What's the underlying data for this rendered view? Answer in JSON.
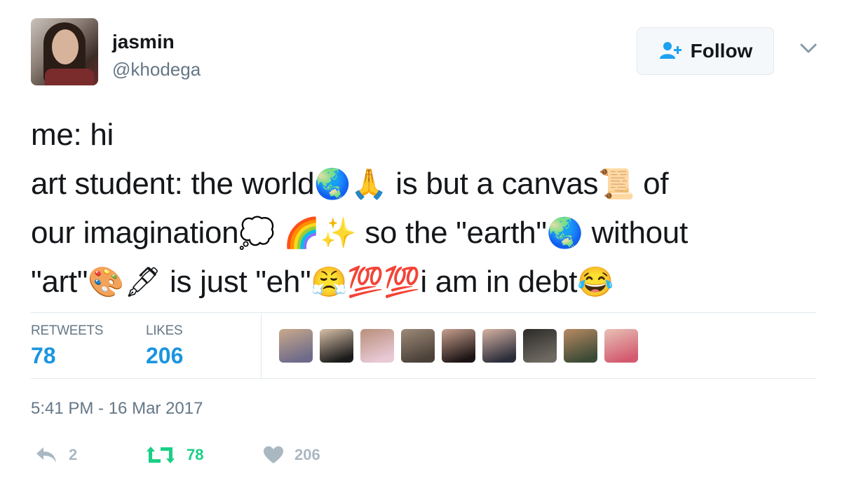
{
  "user": {
    "display_name": "jasmin",
    "handle": "@khodega"
  },
  "follow_button": {
    "label": "Follow",
    "icon": "person-add-icon"
  },
  "tweet": {
    "lines": [
      [
        "me: hi"
      ],
      [
        "art student: the world",
        "🌏",
        "🙏",
        " is but a canvas",
        "📜",
        " of"
      ],
      [
        "our imagination",
        "💭",
        " ",
        "🌈",
        "✨",
        " so the \"earth\"",
        "🌏",
        " without"
      ],
      [
        "\"art\"",
        "🎨",
        "🖋",
        " is just \"eh\"",
        "😤",
        "💯",
        "💯",
        "i am in debt",
        "😂"
      ]
    ]
  },
  "stats": {
    "retweets_label": "RETWEETS",
    "retweets_value": "78",
    "likes_label": "LIKES",
    "likes_value": "206"
  },
  "likers": [
    {
      "color_a": "#6d6a8a",
      "color_b": "#c9a98b"
    },
    {
      "color_a": "#1a1a1a",
      "color_b": "#d8c0a8"
    },
    {
      "color_a": "#e8c9d6",
      "color_b": "#b98f7a"
    },
    {
      "color_a": "#4a4038",
      "color_b": "#9d8a78"
    },
    {
      "color_a": "#1c1414",
      "color_b": "#c79f8e"
    },
    {
      "color_a": "#2b2d3a",
      "color_b": "#d6b3a3"
    },
    {
      "color_a": "#6e6a62",
      "color_b": "#2c2a28"
    },
    {
      "color_a": "#3b4a34",
      "color_b": "#b88a64"
    },
    {
      "color_a": "#d35a6f",
      "color_b": "#e8c1b6"
    }
  ],
  "timestamp": "5:41 PM - 16 Mar 2017",
  "actions": {
    "reply_count": "2",
    "retweet_count": "78",
    "like_count": "206"
  },
  "colors": {
    "accent_blue": "#1b95e0",
    "retweet_green": "#19cf86",
    "muted_gray": "#aab8c2"
  }
}
